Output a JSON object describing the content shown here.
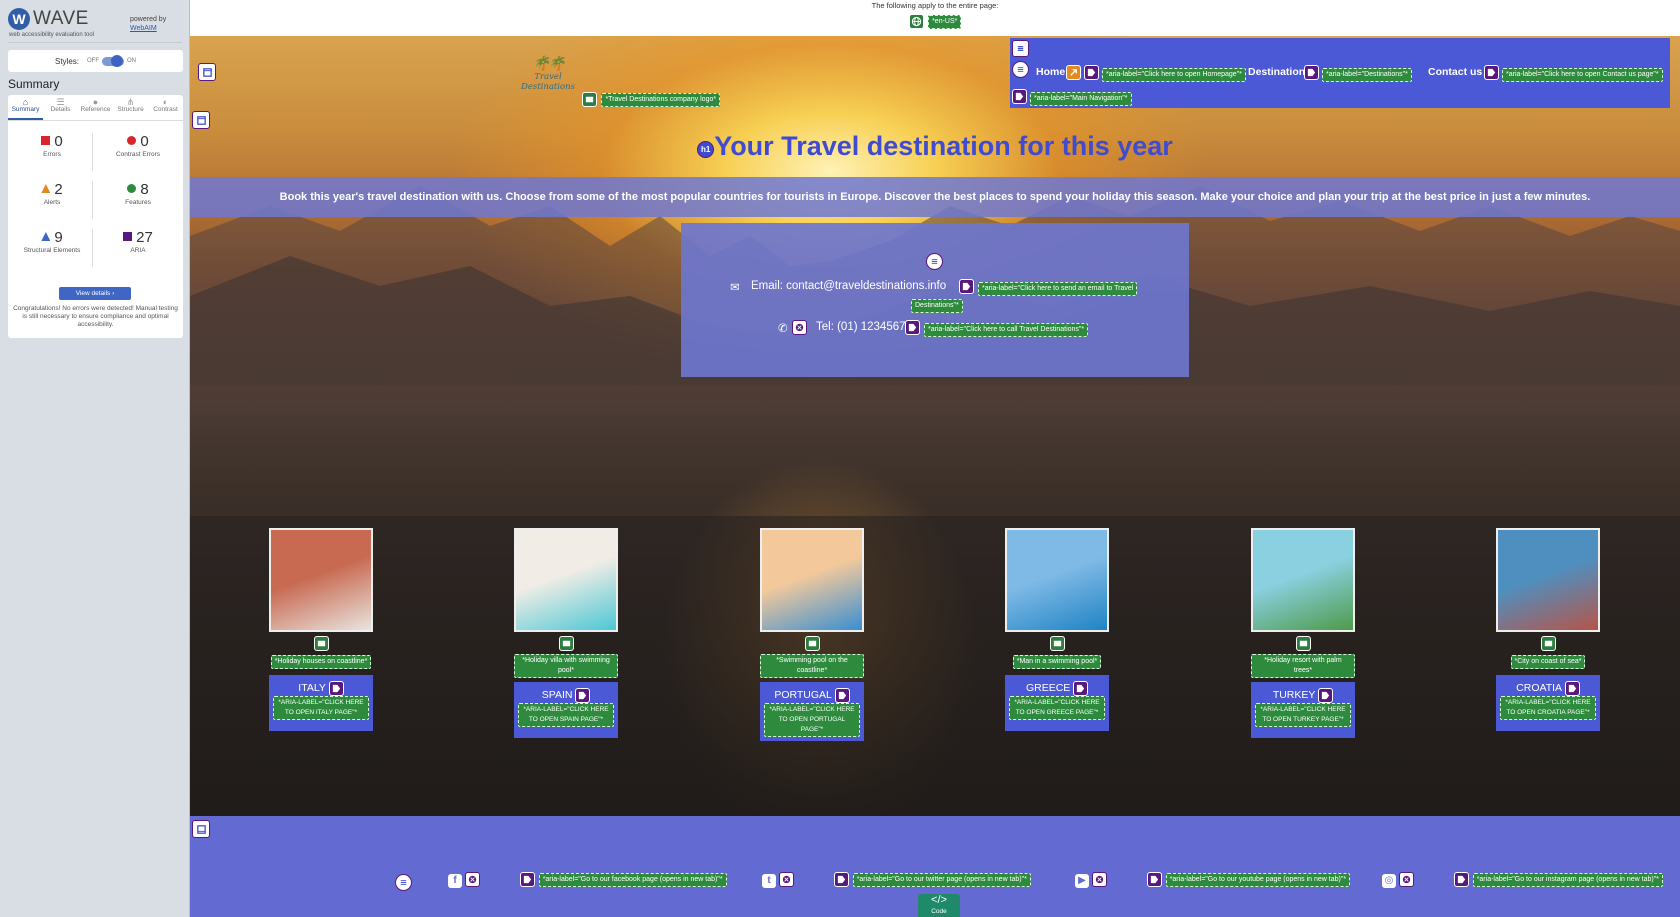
{
  "wave": {
    "logo_letter": "W",
    "logo_text": "WAVE",
    "tagline": "web accessibility evaluation tool",
    "powered_by": "powered by",
    "powered_link": "WebAIM",
    "styles_label": "Styles:",
    "styles_off": "OFF",
    "styles_on": "ON",
    "summary_title": "Summary",
    "tabs": [
      {
        "label": "Summary",
        "icon": "home-icon"
      },
      {
        "label": "Details",
        "icon": "list-icon"
      },
      {
        "label": "Reference",
        "icon": "info-icon"
      },
      {
        "label": "Structure",
        "icon": "structure-icon"
      },
      {
        "label": "Contrast",
        "icon": "contrast-icon"
      }
    ],
    "stats": [
      {
        "value": "0",
        "label": "Errors",
        "color": "#d9262c"
      },
      {
        "value": "0",
        "label": "Contrast Errors",
        "color": "#d9262c"
      },
      {
        "value": "2",
        "label": "Alerts",
        "color": "#e38a1e"
      },
      {
        "value": "8",
        "label": "Features",
        "color": "#2e8b3e"
      },
      {
        "value": "9",
        "label": "Structural Elements",
        "color": "#3f66c4"
      },
      {
        "value": "27",
        "label": "ARIA",
        "color": "#59187d"
      }
    ],
    "view_details": "View details ›",
    "congrats": "Congratulations! No errors were detected! Manual testing is still necessary to ensure compliance and optimal accessibility."
  },
  "page": {
    "top_note": "The following apply to the entire page:",
    "lang_tag": "*en-US*",
    "logo_text": "Travel Destinations",
    "logo_tag": "*Travel Destinations company logo*",
    "nav": {
      "home": "Home",
      "home_aria": "*aria-label=\"Click here to open Homepage\"*",
      "destinations": "Destinations",
      "destinations_aria": "*aria-label=\"Destinations\"*",
      "contact": "Contact us",
      "contact_aria": "*aria-label=\"Click here to open Contact us page\"*",
      "main_aria": "*aria-label=\"Main Navigation\"*"
    },
    "heading": "Your Travel destination for this year",
    "intro": "Book this year's travel destination with us. Choose from some of the most popular countries for tourists in Europe. Discover the best places to spend your holiday this season. Make your choice and plan your trip at the best price in just a few minutes.",
    "email": "Email: contact@traveldestinations.info",
    "email_aria_1": "*aria-label=\"Click here to send an email to Travel",
    "email_aria_2": "Destinations\"*",
    "tel": "Tel: (01) 1234567",
    "tel_aria": "*aria-label=\"Click here to call Travel Destinations\"*",
    "destinations": [
      {
        "name": "ITALY",
        "alt": "*Holiday houses on coastline*",
        "aria": "*ARIA-LABEL=\"CLICK HERE TO OPEN ITALY PAGE\"*",
        "c1": "#c86a52",
        "c2": "#e9e4df"
      },
      {
        "name": "SPAIN",
        "alt": "*Holiday villa with swimming pool*",
        "aria": "*ARIA-LABEL=\"CLICK HERE TO OPEN SPAIN PAGE\"*",
        "c1": "#f1ede6",
        "c2": "#4cc7d4"
      },
      {
        "name": "PORTUGAL",
        "alt": "*Swimming pool on the coastline*",
        "aria": "*ARIA-LABEL=\"CLICK HERE TO OPEN PORTUGAL PAGE\"*",
        "c1": "#f3c99c",
        "c2": "#3a8fd0"
      },
      {
        "name": "GREECE",
        "alt": "*Man in a swimming pool*",
        "aria": "*ARIA-LABEL=\"CLICK HERE TO OPEN GREECE PAGE\"*",
        "c1": "#7fb9e6",
        "c2": "#1f84c4"
      },
      {
        "name": "TURKEY",
        "alt": "*Holiday resort with palm trees*",
        "aria": "*ARIA-LABEL=\"CLICK HERE TO OPEN TURKEY PAGE\"*",
        "c1": "#8ad0e0",
        "c2": "#4f9a4b"
      },
      {
        "name": "CROATIA",
        "alt": "*City on coast of sea*",
        "aria": "*ARIA-LABEL=\"CLICK HERE TO OPEN CROATIA PAGE\"*",
        "c1": "#4f8fbf",
        "c2": "#b5554a"
      }
    ],
    "social": [
      {
        "icon": "facebook-icon",
        "glyph": "f",
        "aria": "*aria-label=\"Go to our facebook page (opens in new tab)\"*"
      },
      {
        "icon": "twitter-icon",
        "glyph": "t",
        "aria": "*aria-label=\"Go to our twitter page (opens in new tab)\"*"
      },
      {
        "icon": "youtube-icon",
        "glyph": "▶",
        "aria": "*aria-label=\"Go to our youtube page (opens in new tab)\"*"
      },
      {
        "icon": "instagram-icon",
        "glyph": "◎",
        "aria": "*aria-label=\"Go to our instagram page (opens in new tab)\"*"
      }
    ],
    "code_button": "</>",
    "code_label": "Code"
  }
}
